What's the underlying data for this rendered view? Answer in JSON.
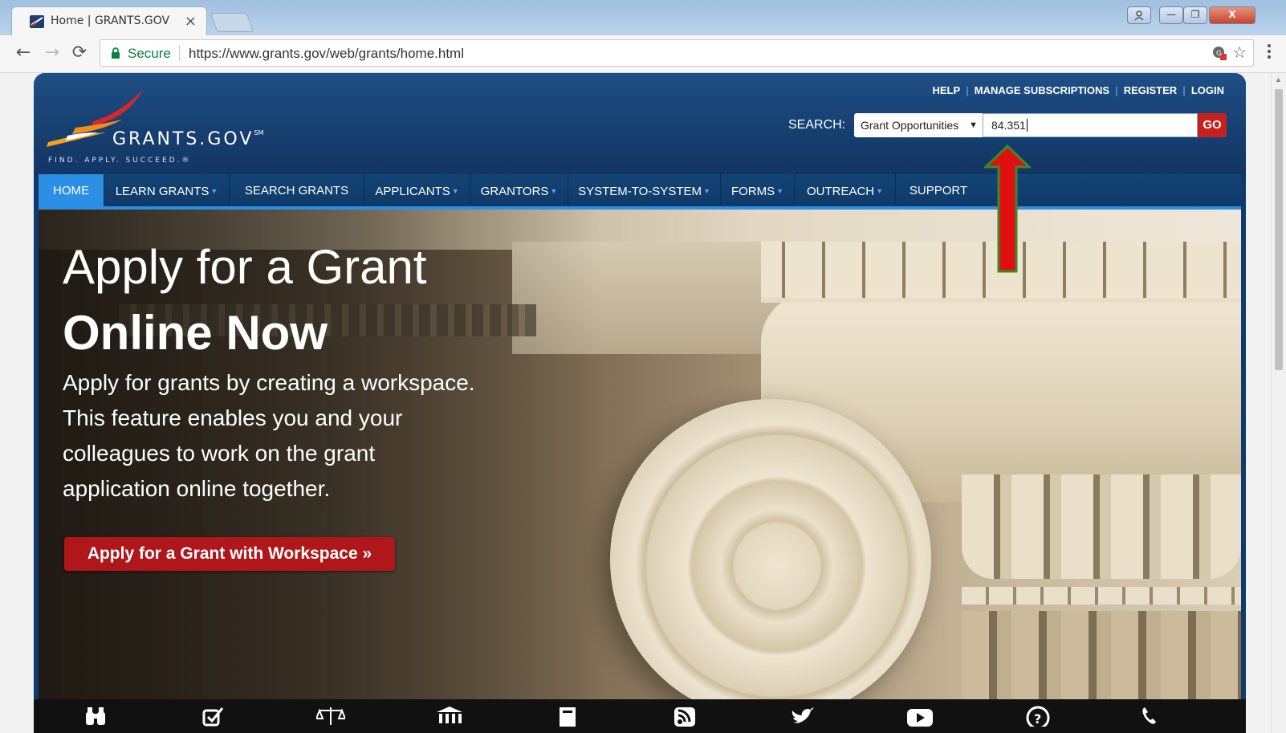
{
  "browser": {
    "tab_title": "Home | GRANTS.GOV",
    "tab_close": "×",
    "window_title": "",
    "window_buttons": [
      "—",
      "❐",
      "X"
    ],
    "secure_label": "Secure",
    "url": "https://www.grants.gov/web/grants/home.html",
    "nav": {
      "back": "←",
      "forward": "→",
      "reload": "⟳"
    },
    "star": "☆"
  },
  "site": {
    "logo_text": "GRANTS.GOV",
    "logo_mark": "SM",
    "tagline": "FIND. APPLY. SUCCEED.",
    "tagline_mark": "®",
    "util_links": [
      "HELP",
      "MANAGE SUBSCRIPTIONS",
      "REGISTER",
      "LOGIN"
    ],
    "search": {
      "label": "SEARCH:",
      "scope": "Grant Opportunities",
      "caret": "▼",
      "query": "84.351",
      "go": "GO"
    },
    "nav": [
      {
        "label": "HOME",
        "active": true,
        "dropdown": false
      },
      {
        "label": "LEARN GRANTS",
        "active": false,
        "dropdown": true
      },
      {
        "label": "SEARCH GRANTS",
        "active": false,
        "dropdown": false
      },
      {
        "label": "APPLICANTS",
        "active": false,
        "dropdown": true
      },
      {
        "label": "GRANTORS",
        "active": false,
        "dropdown": true
      },
      {
        "label": "SYSTEM-TO-SYSTEM",
        "active": false,
        "dropdown": true
      },
      {
        "label": "FORMS",
        "active": false,
        "dropdown": true
      },
      {
        "label": "OUTREACH",
        "active": false,
        "dropdown": true
      },
      {
        "label": "SUPPORT",
        "active": false,
        "dropdown": false
      }
    ],
    "nav_dropdown_glyph": "▼",
    "hero": {
      "title_line1": "Apply for a Grant",
      "title_line2": "Online Now",
      "body": "Apply for grants by creating a workspace. This feature enables you and your colleagues to work on the grant application online together.",
      "cta": "Apply for a Grant with Workspace »"
    },
    "bottom_icons": [
      "binoculars-icon",
      "checkbox-icon",
      "scales-icon",
      "bank-icon",
      "book-icon",
      "rss-icon",
      "twitter-icon",
      "youtube-icon",
      "help-icon",
      "phone-icon"
    ]
  },
  "colors": {
    "header_blue": "#1f4f86",
    "nav_active": "#2b8fe6",
    "go_red": "#c8201e",
    "cta_red": "#b0171a",
    "arrow_red": "#e01010",
    "arrow_outline": "#3a8a2a"
  }
}
